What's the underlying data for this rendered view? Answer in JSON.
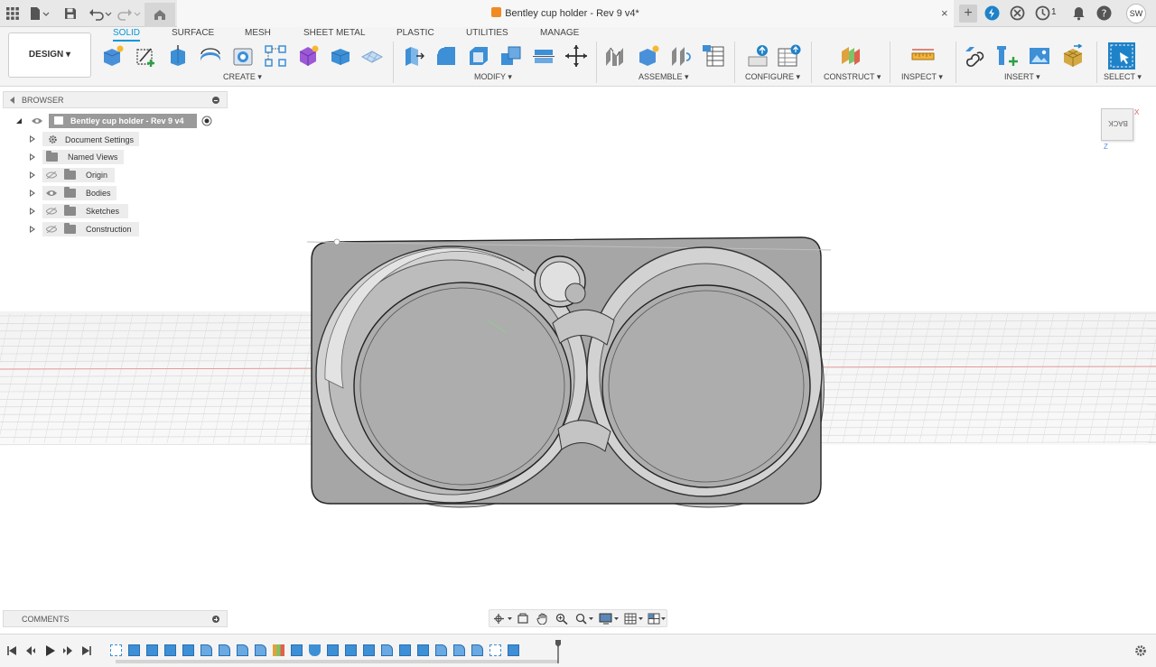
{
  "window": {
    "doc_title": "Bentley cup holder - Rev 9 v4*",
    "tab_close": "×",
    "new_tab": "+",
    "job_count": "1",
    "user_initials": "SW"
  },
  "toolbar": {
    "workspace_label": "DESIGN ▾",
    "tabs": [
      {
        "label": "SOLID",
        "active": true
      },
      {
        "label": "SURFACE",
        "active": false
      },
      {
        "label": "MESH",
        "active": false
      },
      {
        "label": "SHEET METAL",
        "active": false
      },
      {
        "label": "PLASTIC",
        "active": false
      },
      {
        "label": "UTILITIES",
        "active": false
      },
      {
        "label": "MANAGE",
        "active": false
      }
    ],
    "groups": [
      {
        "label": "CREATE ▾"
      },
      {
        "label": "MODIFY ▾"
      },
      {
        "label": "ASSEMBLE ▾"
      },
      {
        "label": "CONFIGURE ▾"
      },
      {
        "label": "CONSTRUCT ▾"
      },
      {
        "label": "INSPECT ▾"
      },
      {
        "label": "INSERT ▾"
      },
      {
        "label": "SELECT ▾"
      }
    ],
    "accent": "#0696d7"
  },
  "browser": {
    "title": "BROWSER",
    "root": "Bentley cup holder - Rev 9 v4",
    "items": [
      {
        "label": "Document Settings",
        "icon": "gear-icon",
        "visible": null
      },
      {
        "label": "Named Views",
        "icon": "folder-icon",
        "visible": null
      },
      {
        "label": "Origin",
        "icon": "folder-icon",
        "visible": false
      },
      {
        "label": "Bodies",
        "icon": "folder-icon",
        "visible": true
      },
      {
        "label": "Sketches",
        "icon": "folder-icon",
        "visible": false
      },
      {
        "label": "Construction",
        "icon": "folder-icon",
        "visible": false
      }
    ]
  },
  "comments": {
    "title": "COMMENTS"
  },
  "viewcube": {
    "face": "BACK",
    "x_axis": "X",
    "z_axis": "Z"
  }
}
